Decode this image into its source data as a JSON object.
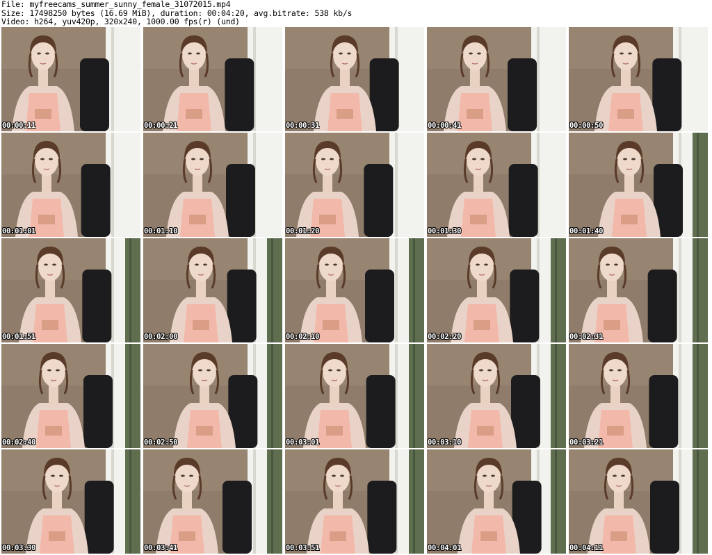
{
  "header": {
    "file_line": "File: myfreecams_summer_sunny_female_31072015.mp4",
    "size_line": "Size: 17498250 bytes (16.69 MiB), duration: 00:04:20, avg.bitrate: 538 kb/s",
    "video_line": "Video: h264, yuv420p, 320x240, 1000.00 fps(r) (und)"
  },
  "thumbnails": [
    {
      "timestamp": "00:00:11",
      "curtain": false
    },
    {
      "timestamp": "00:00:21",
      "curtain": false
    },
    {
      "timestamp": "00:00:31",
      "curtain": false
    },
    {
      "timestamp": "00:00:41",
      "curtain": false
    },
    {
      "timestamp": "00:00:50",
      "curtain": false
    },
    {
      "timestamp": "00:01:01",
      "curtain": false
    },
    {
      "timestamp": "00:01:10",
      "curtain": false
    },
    {
      "timestamp": "00:01:20",
      "curtain": false
    },
    {
      "timestamp": "00:01:30",
      "curtain": false
    },
    {
      "timestamp": "00:01:40",
      "curtain": true
    },
    {
      "timestamp": "00:01:51",
      "curtain": true
    },
    {
      "timestamp": "00:02:00",
      "curtain": true
    },
    {
      "timestamp": "00:02:10",
      "curtain": true
    },
    {
      "timestamp": "00:02:20",
      "curtain": true
    },
    {
      "timestamp": "00:02:31",
      "curtain": true
    },
    {
      "timestamp": "00:02:40",
      "curtain": true
    },
    {
      "timestamp": "00:02:50",
      "curtain": true
    },
    {
      "timestamp": "00:03:01",
      "curtain": true
    },
    {
      "timestamp": "00:03:10",
      "curtain": true
    },
    {
      "timestamp": "00:03:21",
      "curtain": true
    },
    {
      "timestamp": "00:03:30",
      "curtain": true
    },
    {
      "timestamp": "00:03:41",
      "curtain": true
    },
    {
      "timestamp": "00:03:51",
      "curtain": true
    },
    {
      "timestamp": "00:04:01",
      "curtain": true
    },
    {
      "timestamp": "00:04:11",
      "curtain": true
    }
  ]
}
